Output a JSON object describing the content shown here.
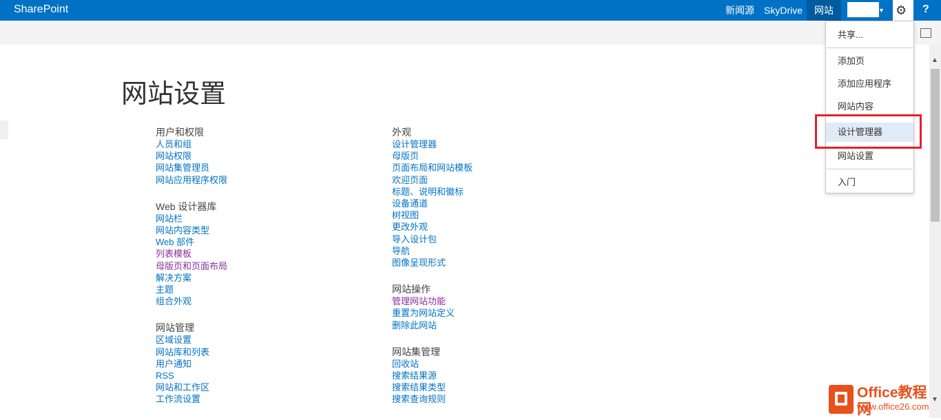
{
  "suite_bar": {
    "brand": "SharePoint",
    "links": {
      "news": "新闻源",
      "skydrive": "SkyDrive",
      "sites": "网站"
    },
    "help": "?"
  },
  "page": {
    "title": "网站设置"
  },
  "columns": [
    {
      "sections": [
        {
          "heading": "用户和权限",
          "links": [
            "人员和组",
            "网站权限",
            "网站集管理员",
            "网站应用程序权限"
          ]
        },
        {
          "heading": "Web 设计器库",
          "links": [
            "网站栏",
            "网站内容类型",
            "Web 部件",
            "列表模板",
            "母版页和页面布局",
            "解决方案",
            "主题",
            "组合外观"
          ]
        },
        {
          "heading": "网站管理",
          "links": [
            "区域设置",
            "网站库和列表",
            "用户通知",
            "RSS",
            "网站和工作区",
            "工作流设置"
          ]
        }
      ]
    },
    {
      "sections": [
        {
          "heading": "外观",
          "links": [
            "设计管理器",
            "母版页",
            "页面布局和网站模板",
            "欢迎页面",
            "标题、说明和徽标",
            "设备通道",
            "树视图",
            "更改外观",
            "导入设计包",
            "导航",
            "图像呈现形式"
          ]
        },
        {
          "heading": "网站操作",
          "links": [
            "管理网站功能",
            "重置为网站定义",
            "删除此网站"
          ]
        },
        {
          "heading": "网站集管理",
          "links": [
            "回收站",
            "搜索结果源",
            "搜索结果类型",
            "搜索查询规则"
          ]
        }
      ]
    }
  ],
  "settings_menu": {
    "items": [
      "共享...",
      "添加页",
      "添加应用程序",
      "网站内容",
      "设计管理器",
      "网站设置",
      "入门"
    ],
    "highlighted_item": "设计管理器"
  },
  "watermark": {
    "title": "Office教程网",
    "subtitle": "www.office26.com"
  },
  "colors": {
    "suite_bar": "#0072c6",
    "link": "#0072c6",
    "visited_link": "#8a2f9b",
    "highlight_box": "#e3202a"
  }
}
